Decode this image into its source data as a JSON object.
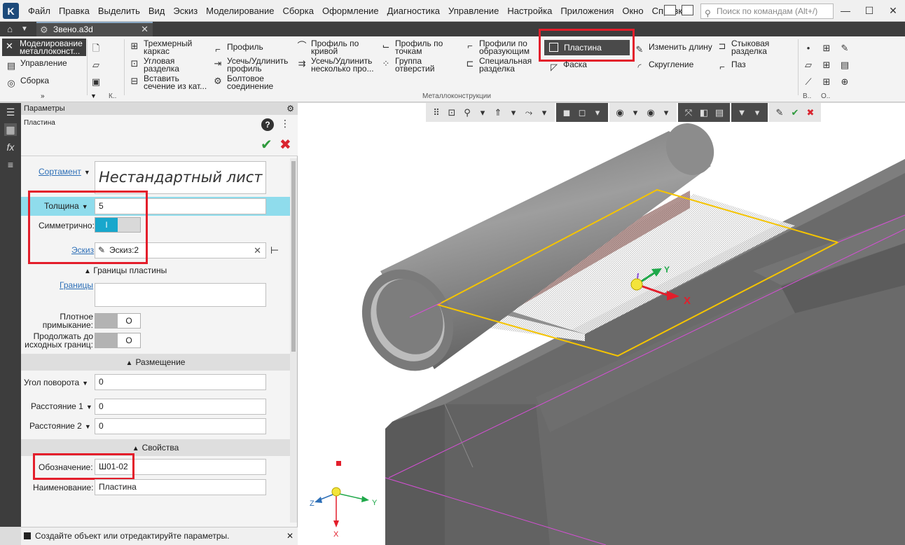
{
  "menu": {
    "items": [
      "Файл",
      "Правка",
      "Выделить",
      "Вид",
      "Эскиз",
      "Моделирование",
      "Сборка",
      "Оформление",
      "Диагностика",
      "Управление",
      "Настройка",
      "Приложения",
      "Окно",
      "Справка"
    ],
    "search_placeholder": "Поиск по командам (Alt+/)"
  },
  "document_tab": {
    "title": "Звено.a3d"
  },
  "ribbon": {
    "mode_label": "Моделирование металлоконст...",
    "mode_items": [
      "Управление",
      "Сборка"
    ],
    "small_group_label": "К..",
    "group_label": "Металлоконструкции",
    "right_labels": [
      "В..",
      "О.."
    ],
    "commands": {
      "wireframe": "Трехмерный каркас",
      "corner_joint": "Угловая разделка",
      "insert_section": "Вставить сечение из кат...",
      "profile": "Профиль",
      "trim_extend_profile": "Усечь/Удлинить профиль",
      "bolted_joint": "Болтовое соединение",
      "profile_by_curve": "Профиль по кривой",
      "trim_extend_several": "Усечь/Удлинить несколько про...",
      "profile_by_points": "Профиль по точкам",
      "hole_group": "Группа отверстий",
      "profiles_by_generator": "Профили по образующим",
      "special_joint": "Специальная разделка",
      "plate": "Пластина",
      "chamfer": "Фаска",
      "change_length": "Изменить длину",
      "fillet": "Скругление",
      "butt_joint": "Стыковая разделка",
      "groove": "Паз"
    }
  },
  "panel": {
    "header": "Параметры",
    "object": "Пластина",
    "sortament_label": "Сортамент",
    "sortament_value": "Нестандартный лист",
    "thickness_label": "Толщина",
    "thickness_value": "5",
    "symmetric_label": "Симметрично:",
    "symmetric_state": "I",
    "sketch_label": "Эскиз",
    "sketch_value": "Эскиз:2",
    "plate_bounds_header": "Границы пластины",
    "bounds_label": "Границы",
    "tight_fit_label_1": "Плотное",
    "tight_fit_label_2": "примыкание:",
    "tight_fit_state": "O",
    "continue_label_1": "Продолжать до",
    "continue_label_2": "исходных границ:",
    "continue_state": "O",
    "placement_header": "Размещение",
    "rotation_label": "Угол поворота",
    "rotation_value": "0",
    "distance1_label": "Расстояние 1",
    "distance1_value": "0",
    "distance2_label": "Расстояние 2",
    "distance2_value": "0",
    "properties_header": "Свойства",
    "designation_label": "Обозначение:",
    "designation_value": "Ш01-02",
    "name_label": "Наименование:",
    "name_value": "Пластина"
  },
  "status": {
    "text": "Создайте объект или отредактируйте параметры."
  },
  "viewport": {
    "axis_x": "X",
    "axis_y": "Y",
    "axis_z": "Z",
    "tube_color": "#8c8c8c",
    "frame_color": "#6a6a6a",
    "plate_outline_color": "#f5c400",
    "sketch_line_color": "#d64fd6"
  },
  "colors": {
    "accent": "#18a7cc",
    "highlight": "#e31e2b",
    "ok": "#2e9a3c"
  }
}
